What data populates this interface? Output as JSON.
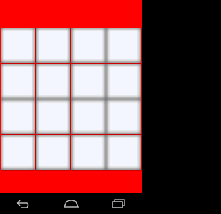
{
  "game": {
    "background_color": "#ff0000",
    "tile_color": "#f4f6ff",
    "tile_border_color": "#5e5e5e",
    "rows": 4,
    "columns": 4
  },
  "navbar": {
    "background_color": "#000000",
    "icon_color": "#b8b8b8",
    "buttons": [
      "back-icon",
      "home-icon",
      "recent-apps-icon"
    ]
  }
}
